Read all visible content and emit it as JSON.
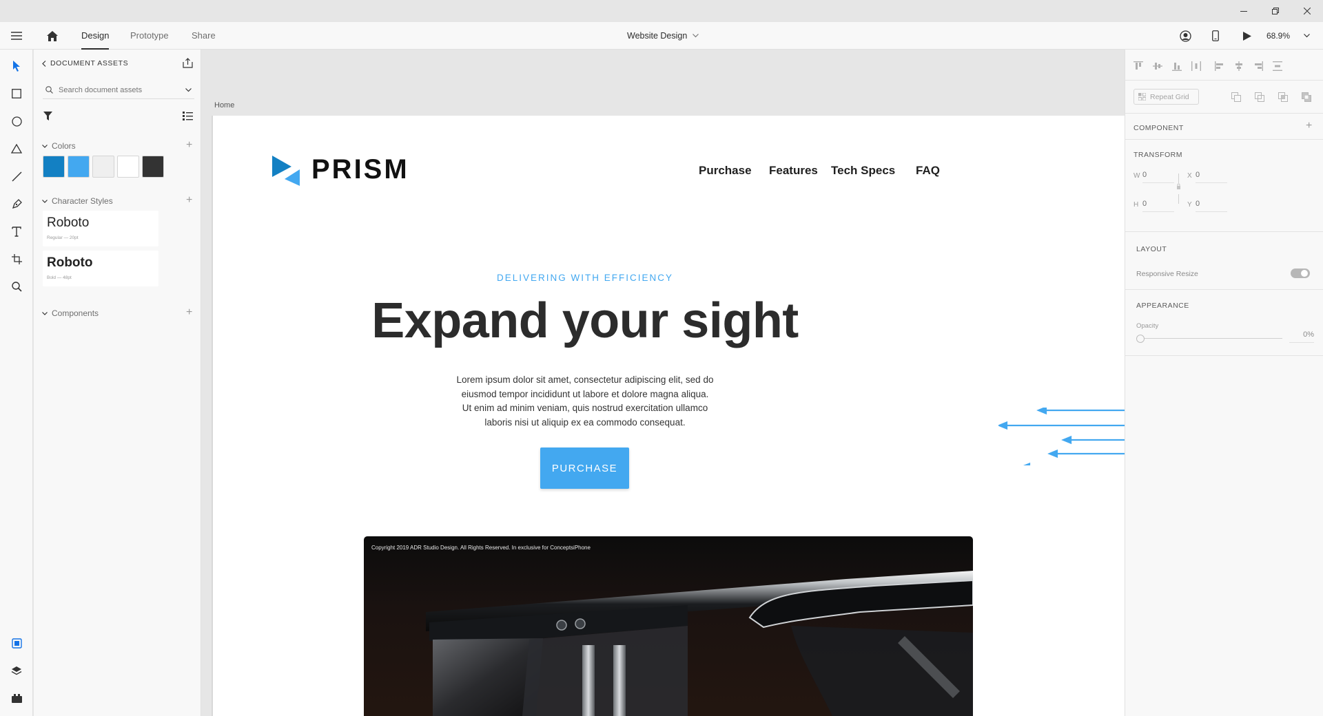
{
  "window": {
    "minimize_icon": "minimize-icon",
    "restore_icon": "restore-icon",
    "close_icon": "close-icon"
  },
  "topbar": {
    "tabs": [
      {
        "label": "Design",
        "active": true
      },
      {
        "label": "Prototype",
        "active": false
      },
      {
        "label": "Share",
        "active": false
      }
    ],
    "document_title": "Website Design",
    "zoom": "68.9%"
  },
  "assets": {
    "header": "DOCUMENT ASSETS",
    "search_placeholder": "Search document assets",
    "colors_label": "Colors",
    "colors": [
      "#1380c3",
      "#43a8f0",
      "#efefef",
      "#ffffff",
      "#333333"
    ],
    "character_styles_label": "Character Styles",
    "character_styles": [
      {
        "name": "Roboto",
        "detail": "Regular — 20pt"
      },
      {
        "name": "Roboto",
        "detail": "Bold — 48pt"
      }
    ],
    "components_label": "Components"
  },
  "canvas": {
    "artboard_name": "Home",
    "site": {
      "logo_text": "PRISM",
      "nav": [
        "Purchase",
        "Features",
        "Tech Specs",
        "FAQ"
      ],
      "eyebrow": "DELIVERING WITH EFFICIENCY",
      "headline": "Expand your sight",
      "body_lines": [
        "Lorem ipsum dolor sit amet, consectetur adipiscing elit, sed do",
        "eiusmod tempor incididunt ut labore et dolore magna aliqua.",
        "Ut enim ad minim veniam, quis nostrud exercitation ullamco",
        "laboris nisi ut aliquip ex ea commodo consequat."
      ],
      "cta": "PURCHASE",
      "image_caption": "Copyright 2019 ADR Studio Design. All Rights Reserved. In exclusive for ConceptsiPhone"
    }
  },
  "props": {
    "repeat_grid": "Repeat Grid",
    "component_label": "COMPONENT",
    "transform_label": "TRANSFORM",
    "w_label": "W",
    "w_value": "0",
    "x_label": "X",
    "x_value": "0",
    "h_label": "H",
    "h_value": "0",
    "y_label": "Y",
    "y_value": "0",
    "layout_label": "LAYOUT",
    "responsive_resize": "Responsive Resize",
    "appearance_label": "APPEARANCE",
    "opacity_label": "Opacity",
    "opacity_value": "0%"
  },
  "colors": {
    "accent": "#43a8f0",
    "brand_dark": "#1380c3"
  }
}
